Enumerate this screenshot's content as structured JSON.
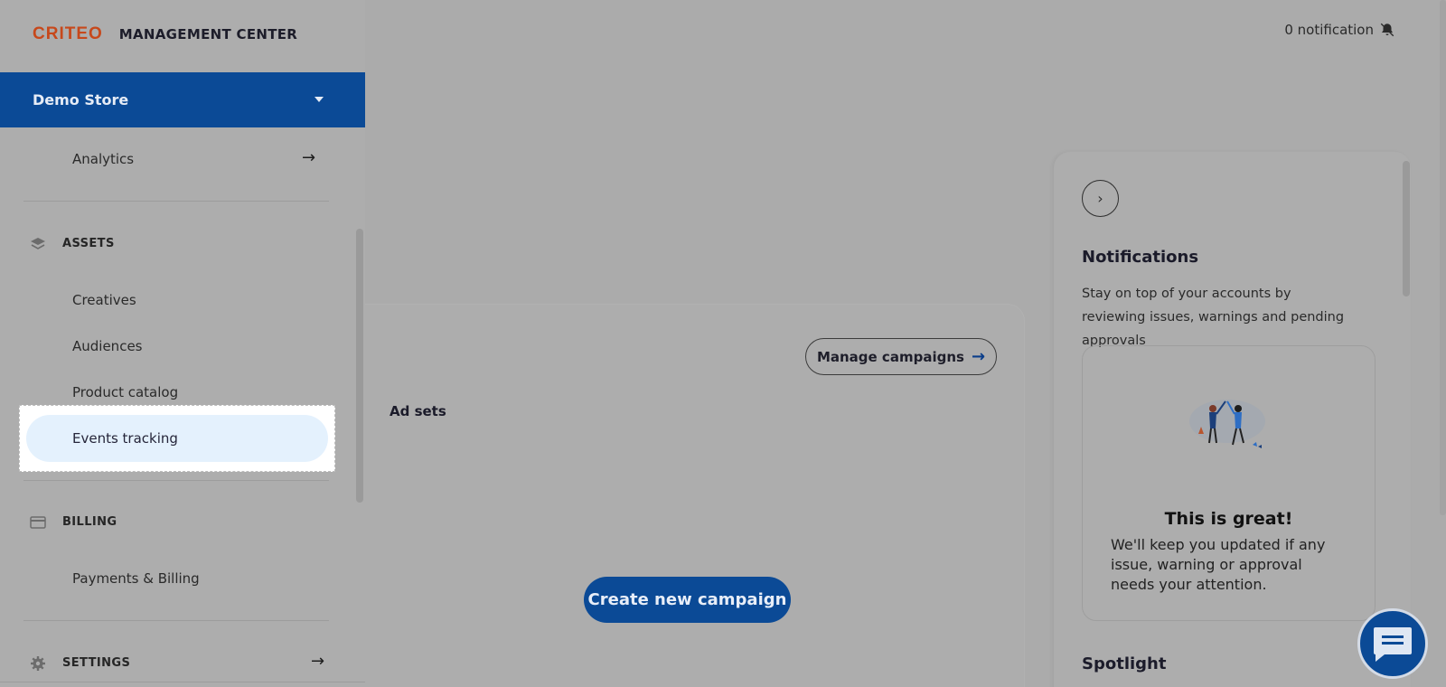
{
  "app": {
    "logo_text": "CRITEO",
    "title": "MANAGEMENT CENTER",
    "brand_color": "#c7481b",
    "accent_color": "#0b4a96"
  },
  "topbar": {
    "notification_text": "0 notification",
    "notification_icon": "bell-icon"
  },
  "sidebar": {
    "store": {
      "label": "Demo Store",
      "icon": "caret-down-icon"
    },
    "items": [
      {
        "label": "Analytics",
        "icon": "arrow-right-icon"
      },
      {
        "label": "Creatives"
      },
      {
        "label": "Audiences"
      },
      {
        "label": "Product catalog"
      },
      {
        "label": "Events tracking",
        "selected": true
      },
      {
        "label": "Payments & Billing"
      }
    ],
    "sections": [
      {
        "label": "ASSETS",
        "icon": "layers-icon"
      },
      {
        "label": "BILLING",
        "icon": "credit-card-icon"
      },
      {
        "label": "SETTINGS",
        "icon": "gear-icon"
      }
    ]
  },
  "campaigns_card": {
    "manage_label": "Manage campaigns",
    "adsets_label": "Ad sets",
    "create_label": "Create new campaign"
  },
  "notifications_panel": {
    "title": "Notifications",
    "description": "Stay on top of your accounts by reviewing issues, warnings and pending approvals",
    "empty_title": "This is great!",
    "empty_description": "We'll keep you updated if any issue, warning or approval needs your attention.",
    "spotlight_label": "Spotlight"
  },
  "chat": {
    "icon": "chat-icon"
  }
}
